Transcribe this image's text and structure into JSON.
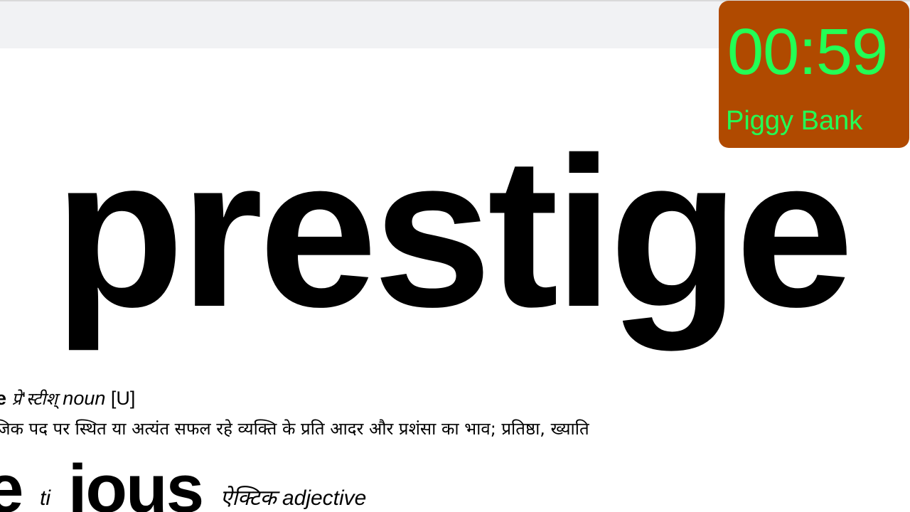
{
  "colors": {
    "top_bar": "#f1f2f4",
    "timer_background": "#b04a00",
    "timer_text": "#22ff55",
    "text": "#000000"
  },
  "entry": {
    "headword": "prestige",
    "headword_prefix": "e",
    "pronunciation": "प्रे'स्टीश्",
    "part_of_speech": "noun",
    "grammar": "[U]",
    "definition": "ाजिक पद पर स्थित या अत्यंत सफल रहे व्यक्ति के प्रति आदर और प्रशंसा का भाव; प्रतिष्ठा, ख्याति"
  },
  "next_entry": {
    "head_start": "e",
    "fragment_small": "ti",
    "head_end": "ious",
    "trailing_small": "ऐक्टिक adjective"
  },
  "timer": {
    "value": "00:59",
    "label": "Piggy Bank"
  }
}
